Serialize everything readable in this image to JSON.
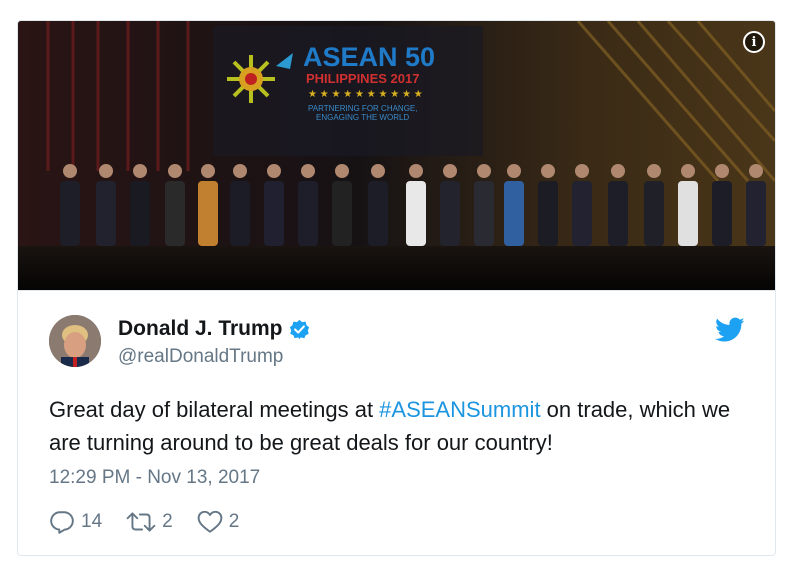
{
  "media": {
    "banner_title": "ASEAN 50",
    "banner_subtitle": "PHILIPPINES 2017",
    "banner_tagline_1": "PARTNERING FOR CHANGE,",
    "banner_tagline_2": "ENGAGING THE WORLD",
    "info_label": "i"
  },
  "author": {
    "name": "Donald J. Trump",
    "handle": "@realDonaldTrump"
  },
  "tweet": {
    "text_before": "Great day of bilateral meetings at ",
    "hashtag": "#ASEANSummit",
    "text_after": " on trade, which we are turning around to be great deals for our country!",
    "timestamp": "12:29 PM - Nov 13, 2017"
  },
  "actions": {
    "reply_count": "14",
    "retweet_count": "2",
    "like_count": "2"
  },
  "colors": {
    "link": "#1b95e0",
    "muted": "#657786",
    "twitter_blue": "#1da1f2"
  }
}
